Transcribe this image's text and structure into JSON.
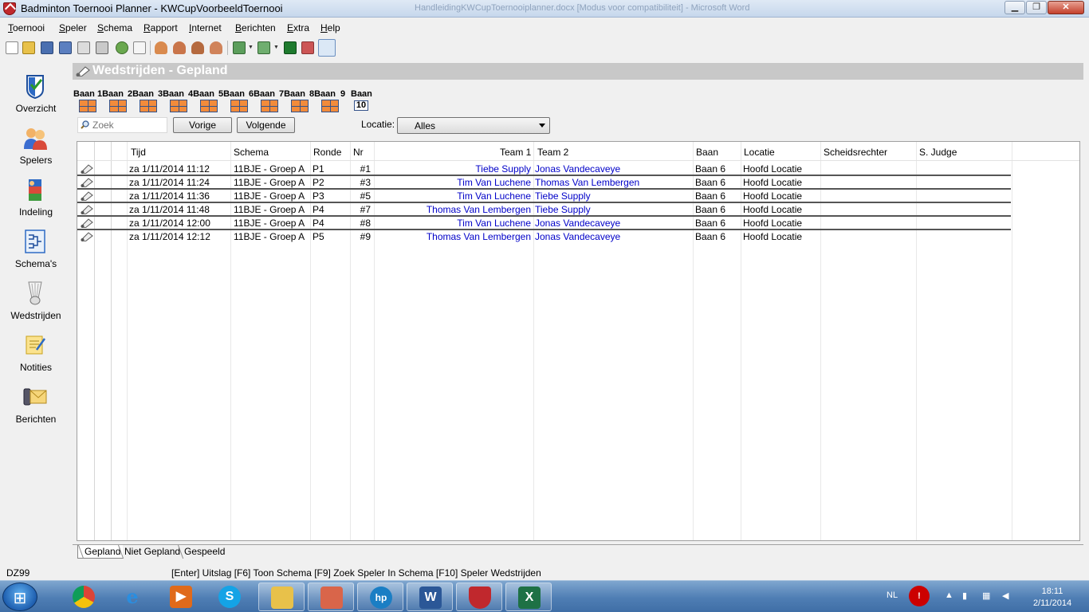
{
  "window": {
    "title": "Badminton Toernooi Planner - KWCupVoorbeeldToernooi",
    "background_title": "HandleidingKWCupToernooiplanner.docx [Modus voor compatibiliteit] - Microsoft Word",
    "min": "▁",
    "max": "❐",
    "close": "✕"
  },
  "menu": {
    "items": [
      {
        "label": "Toernooi"
      },
      {
        "label": "Speler"
      },
      {
        "label": "Schema"
      },
      {
        "label": "Rapport"
      },
      {
        "label": "Internet"
      },
      {
        "label": "Berichten"
      },
      {
        "label": "Extra"
      },
      {
        "label": "Help"
      }
    ]
  },
  "toolbar": {
    "icons": [
      "new-file-icon",
      "open-folder-icon",
      "save-icon",
      "save-as-icon",
      "print-preview-icon",
      "print-icon",
      "web-icon",
      "mail-icon",
      "player-icon",
      "player-add-icon",
      "player-search-icon",
      "player-group-icon",
      "schedule-icon",
      "schedule-options-icon",
      "court-icon",
      "export-icon",
      "search-icon"
    ]
  },
  "nav": {
    "items": [
      {
        "label": "Overzicht",
        "icon": "overview-icon"
      },
      {
        "label": "Spelers",
        "icon": "players-icon"
      },
      {
        "label": "Indeling",
        "icon": "draw-icon"
      },
      {
        "label": "Schema's",
        "icon": "bracket-icon"
      },
      {
        "label": "Wedstrijden",
        "icon": "shuttlecock-icon"
      },
      {
        "label": "Notities",
        "icon": "notes-icon"
      },
      {
        "label": "Berichten",
        "icon": "messages-icon"
      }
    ]
  },
  "panel": {
    "title": "Wedstrijden - Gepland"
  },
  "courts": {
    "labels": [
      "Baan",
      "1Baan",
      "2Baan",
      "3Baan",
      "4Baan",
      "5Baan",
      "6Baan",
      "7Baan",
      "8Baan",
      "9",
      "Baan"
    ],
    "last_number": "10"
  },
  "search": {
    "placeholder": "Zoek",
    "prev": "Vorige",
    "next": "Volgende",
    "location_label": "Locatie:",
    "location_value": "Alles"
  },
  "table": {
    "headers": {
      "tijd": "Tijd",
      "schema": "Schema",
      "ronde": "Ronde",
      "nr": "Nr",
      "team1": "Team 1",
      "team2": "Team 2",
      "baan": "Baan",
      "locatie": "Locatie",
      "scheidsrechter": "Scheidsrechter",
      "sjudge": "S. Judge"
    },
    "rows": [
      {
        "tijd": "za 1/11/2014 11:12",
        "schema": "11BJE - Groep A",
        "ronde": "P1",
        "nr": "#1",
        "team1": "Tiebe Supply",
        "team2": "Jonas Vandecaveye",
        "baan": "Baan 6",
        "locatie": "Hoofd Locatie"
      },
      {
        "tijd": "za 1/11/2014 11:24",
        "schema": "11BJE - Groep A",
        "ronde": "P2",
        "nr": "#3",
        "team1": "Tim Van Luchene",
        "team2": "Thomas Van Lembergen",
        "baan": "Baan 6",
        "locatie": "Hoofd Locatie"
      },
      {
        "tijd": "za 1/11/2014 11:36",
        "schema": "11BJE - Groep A",
        "ronde": "P3",
        "nr": "#5",
        "team1": "Tim Van Luchene",
        "team2": "Tiebe Supply",
        "baan": "Baan 6",
        "locatie": "Hoofd Locatie"
      },
      {
        "tijd": "za 1/11/2014 11:48",
        "schema": "11BJE - Groep A",
        "ronde": "P4",
        "nr": "#7",
        "team1": "Thomas Van Lembergen",
        "team2": "Tiebe Supply",
        "baan": "Baan 6",
        "locatie": "Hoofd Locatie"
      },
      {
        "tijd": "za 1/11/2014 12:00",
        "schema": "11BJE - Groep A",
        "ronde": "P4",
        "nr": "#8",
        "team1": "Tim Van Luchene",
        "team2": "Jonas Vandecaveye",
        "baan": "Baan 6",
        "locatie": "Hoofd Locatie"
      },
      {
        "tijd": "za 1/11/2014 12:12",
        "schema": "11BJE - Groep A",
        "ronde": "P5",
        "nr": "#9",
        "team1": "Thomas Van Lembergen",
        "team2": "Jonas Vandecaveye",
        "baan": "Baan 6",
        "locatie": "Hoofd Locatie"
      }
    ]
  },
  "tabs": [
    {
      "label": "Gepland",
      "active": true
    },
    {
      "label": "Niet Gepland",
      "active": false
    },
    {
      "label": "Gespeeld",
      "active": false
    }
  ],
  "status": {
    "left": "DZ99",
    "hint": "[Enter] Uitslag [F6] Toon Schema [F9] Zoek Speler In Schema [F10] Speler Wedstrijden"
  },
  "taskbar": {
    "apps": [
      "chrome-icon",
      "internet-explorer-icon",
      "media-player-icon",
      "skype-icon",
      "explorer-icon",
      "presentation-icon",
      "hp-icon",
      "word-icon",
      "badminton-planner-icon",
      "excel-icon"
    ],
    "language": "NL",
    "time": "18:11",
    "date": "2/11/2014"
  },
  "colors": {
    "accent_blue": "#0000c8",
    "header_gray": "#c8c8c8",
    "court_orange": "#f28b3b",
    "taskbar": "#4f7eb4"
  }
}
